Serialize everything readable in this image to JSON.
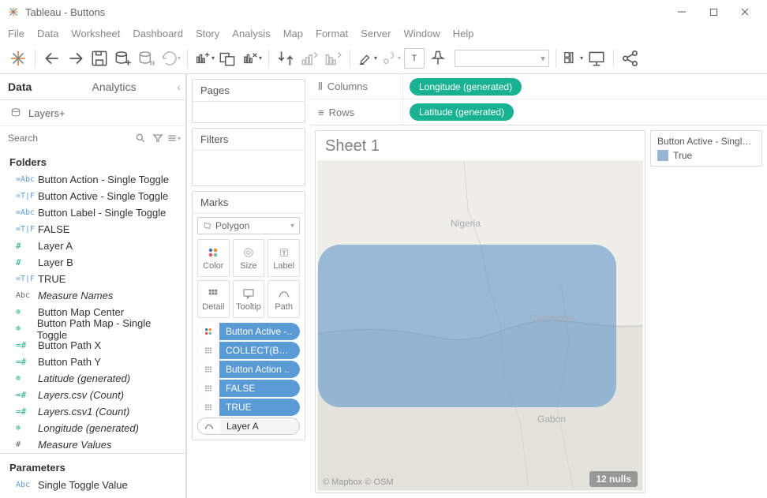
{
  "window": {
    "title": "Tableau - Buttons"
  },
  "menu": [
    "File",
    "Data",
    "Worksheet",
    "Dashboard",
    "Story",
    "Analysis",
    "Map",
    "Format",
    "Server",
    "Window",
    "Help"
  ],
  "sidebar": {
    "tab_data": "Data",
    "tab_analytics": "Analytics",
    "datasource": "Layers+",
    "search_placeholder": "Search",
    "folders_hdr": "Folders",
    "params_hdr": "Parameters"
  },
  "fields": [
    {
      "icon": "=Abc",
      "cls": "abc",
      "label": "Button Action - Single Toggle"
    },
    {
      "icon": "=T|F",
      "cls": "tf",
      "label": "Button Active - Single Toggle"
    },
    {
      "icon": "=Abc",
      "cls": "abc",
      "label": "Button Label - Single Toggle"
    },
    {
      "icon": "=T|F",
      "cls": "tf",
      "label": "FALSE"
    },
    {
      "icon": "#",
      "cls": "hash",
      "label": "Layer A"
    },
    {
      "icon": "#",
      "cls": "hash",
      "label": "Layer B"
    },
    {
      "icon": "=T|F",
      "cls": "tf",
      "label": "TRUE"
    },
    {
      "icon": "Abc",
      "cls": "measure",
      "label": "Measure Names",
      "italic": true
    },
    {
      "icon": "⊕",
      "cls": "globe",
      "label": "Button Map Center"
    },
    {
      "icon": "⊕",
      "cls": "globe",
      "label": "Button Path Map - Single Toggle"
    },
    {
      "icon": "=#",
      "cls": "hash",
      "label": "Button Path X"
    },
    {
      "icon": "=#",
      "cls": "hash",
      "label": "Button Path Y"
    },
    {
      "icon": "⊕",
      "cls": "globe",
      "label": "Latitude (generated)",
      "italic": true
    },
    {
      "icon": "=#",
      "cls": "hash",
      "label": "Layers.csv (Count)",
      "italic": true
    },
    {
      "icon": "=#",
      "cls": "hash",
      "label": "Layers.csv1 (Count)",
      "italic": true
    },
    {
      "icon": "⊕",
      "cls": "globe",
      "label": "Longitude (generated)",
      "italic": true
    },
    {
      "icon": "#",
      "cls": "measure",
      "label": "Measure Values",
      "italic": true
    }
  ],
  "params": [
    {
      "icon": "Abc",
      "cls": "abc",
      "label": "Single Toggle Value"
    }
  ],
  "cards": {
    "pages": "Pages",
    "filters": "Filters",
    "marks": "Marks",
    "mark_type": "Polygon",
    "cells": [
      "Color",
      "Size",
      "Label",
      "Detail",
      "Tooltip",
      "Path"
    ]
  },
  "mark_pills": [
    {
      "type": "color",
      "label": "Button Active -.."
    },
    {
      "type": "detail",
      "label": "COLLECT(Butt.."
    },
    {
      "type": "detail",
      "label": "Button Action .."
    },
    {
      "type": "detail",
      "label": "FALSE"
    },
    {
      "type": "detail",
      "label": "TRUE"
    },
    {
      "type": "path",
      "label": "Layer A"
    }
  ],
  "shelves": {
    "columns": "Columns",
    "rows": "Rows",
    "col_pill": "Longitude (generated)",
    "row_pill": "Latitude (generated)"
  },
  "sheet": {
    "title": "Sheet 1",
    "labels": {
      "nigeria": "Nigeria",
      "cameroon": "Cameroon",
      "gabon": "Gabon"
    },
    "attribution": "© Mapbox © OSM",
    "nulls": "12 nulls"
  },
  "legend": {
    "title": "Button Active - Single T...",
    "item": "True"
  }
}
